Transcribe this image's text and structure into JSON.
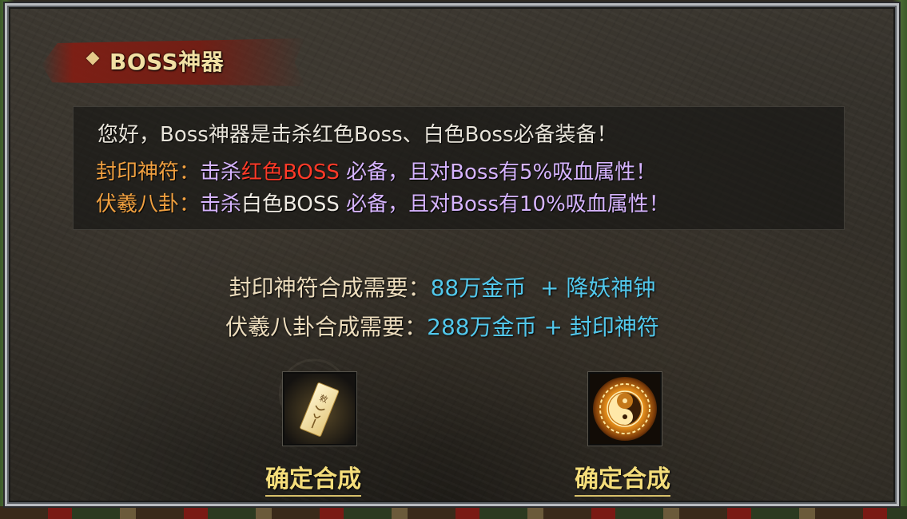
{
  "panel": {
    "title": "BOSS神器"
  },
  "info": {
    "line1": "您好，Boss神器是击杀红色Boss、白色Boss必备装备！",
    "line2": {
      "name": "封印神符：",
      "kill": "击杀",
      "boss": "红色BOSS",
      "rest": "必备，且对Boss有5%吸血属性！"
    },
    "line3": {
      "name": "伏羲八卦：",
      "kill": "击杀",
      "boss": "白色BOSS",
      "rest": "必备，且对Boss有10%吸血属性！"
    }
  },
  "recipes": [
    {
      "label": "封印神符合成需要：",
      "cost": "88万金币",
      "sep": "  + ",
      "material": "降妖神钟"
    },
    {
      "label": "伏羲八卦合成需要：",
      "cost": "288万金币",
      "sep": " + ",
      "material": "封印神符"
    }
  ],
  "items": [
    {
      "icon": "talisman-icon",
      "button": "确定合成"
    },
    {
      "icon": "bagua-compass-icon",
      "button": "确定合成"
    }
  ],
  "colors": {
    "title": "#f1e0a4",
    "orange": "#f0a040",
    "lavender": "#d6b4ff",
    "red": "#ff3a28",
    "cyan": "#52c8ec",
    "confirm": "#f4dd7a"
  }
}
